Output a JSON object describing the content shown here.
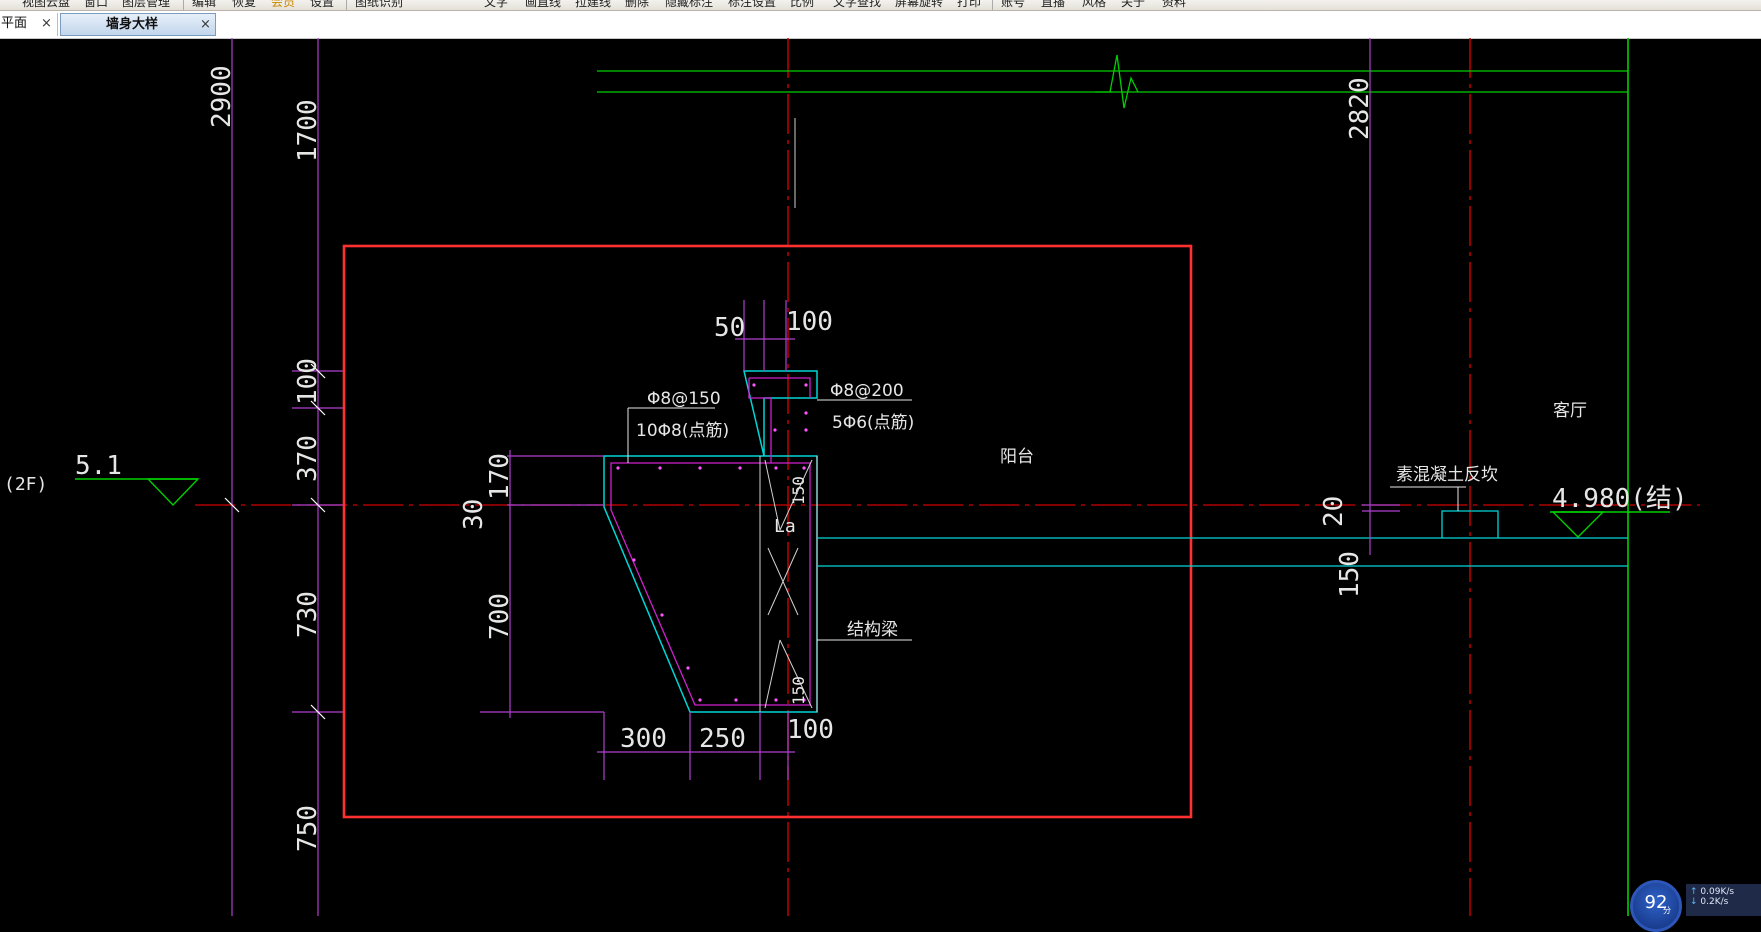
{
  "menu": {
    "items": [
      "视图云盘",
      "窗口",
      "图层管理",
      "编辑",
      "恢复",
      "会员",
      "设置",
      "图纸识别",
      "文字",
      "画直线",
      "拉建线",
      "删除",
      "隐藏标注",
      "标注设置",
      "比例",
      "文字查找",
      "屏幕旋转",
      "打印",
      "账号",
      "直播",
      "风格",
      "关于",
      "资料"
    ]
  },
  "tabs": [
    {
      "label": "平面",
      "close": "×"
    },
    {
      "label": "墙身大样",
      "close": "×"
    }
  ],
  "drawing": {
    "left_dims": [
      "2900",
      "1700",
      "100",
      "370",
      "730",
      "750"
    ],
    "level_left_value": "5.1",
    "floor_label": "(2F)",
    "level_right_value": "4.980(结)",
    "top_dims": [
      "50",
      "100"
    ],
    "bottom_dims": [
      "300",
      "250",
      "100"
    ],
    "section_vertical_dims": [
      "170",
      "30",
      "700"
    ],
    "right_dims": [
      "2820",
      "20",
      "150"
    ],
    "rebar_annotations": {
      "left_top": "Φ8@150",
      "left_bottom": "10Φ8(点筋)",
      "right_top": "Φ8@200",
      "right_bottom": "5Φ6(点筋)"
    },
    "inner_labels": {
      "dim_150_top": "150",
      "la": "La",
      "dim_150_bottom": "150"
    },
    "beam_label": "结构梁",
    "balcony_label": "阳台",
    "living_room_label": "客厅",
    "concrete_upturn_label": "素混凝土反坎"
  },
  "net_widget": {
    "score": "92",
    "unit": "分",
    "upload_speed": "0.09K/s",
    "download_speed": "0.2K/s"
  }
}
